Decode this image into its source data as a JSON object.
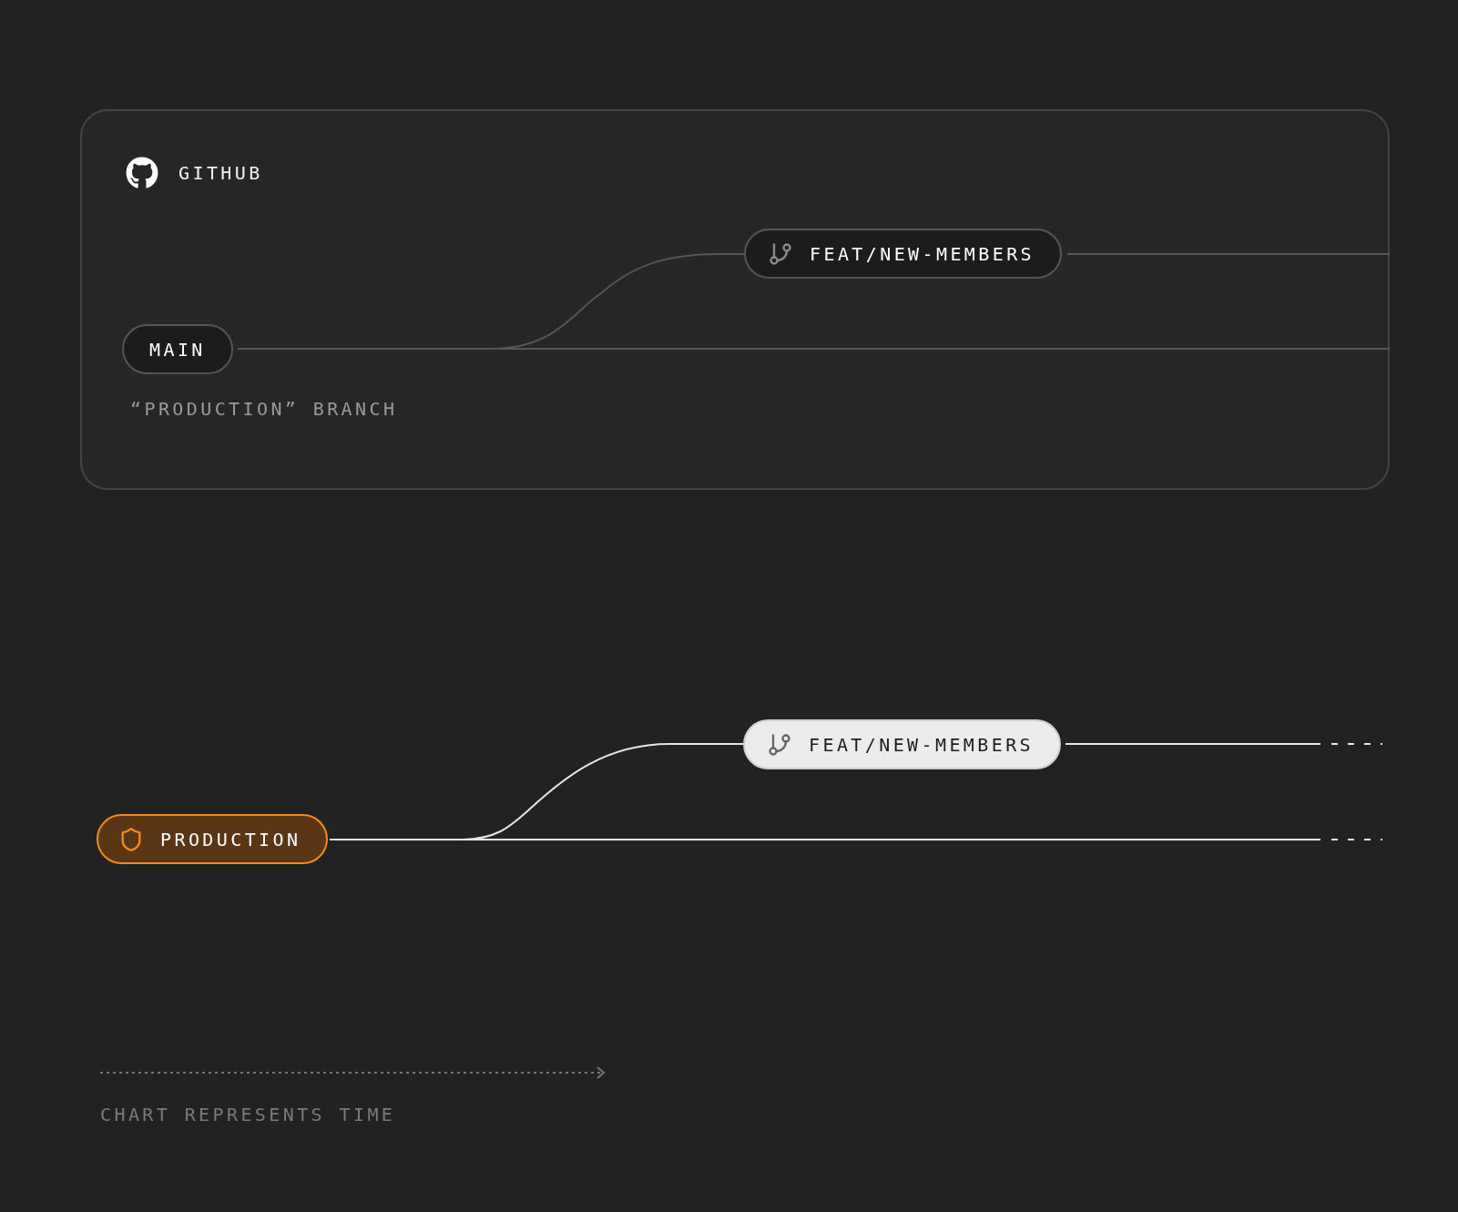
{
  "github": {
    "title": "GITHUB",
    "main_branch": "MAIN",
    "branch_caption": "“PRODUCTION” BRANCH",
    "feature_branch": "FEAT/NEW-MEMBERS"
  },
  "deploy": {
    "production_branch": "PRODUCTION",
    "feature_branch": "FEAT/NEW-MEMBERS"
  },
  "time_axis": {
    "label": "CHART REPRESENTS TIME"
  }
}
